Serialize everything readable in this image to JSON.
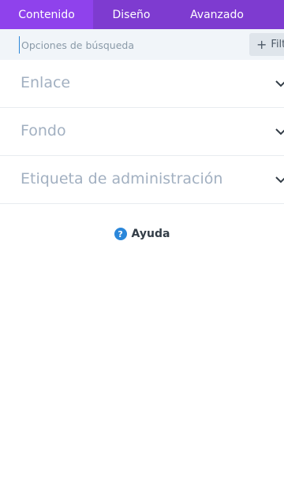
{
  "tabs": [
    {
      "label": "Contenido",
      "active": true
    },
    {
      "label": "Diseño",
      "active": false
    },
    {
      "label": "Avanzado",
      "active": false
    }
  ],
  "search": {
    "placeholder": "Opciones de búsqueda",
    "value": ""
  },
  "filter_button": {
    "label": "Filtro",
    "icon": "plus-icon"
  },
  "groups": [
    {
      "label": "Enlace",
      "icon": "chevron-down-icon"
    },
    {
      "label": "Fondo",
      "icon": "chevron-down-icon"
    },
    {
      "label": "Etiqueta de administración",
      "icon": "chevron-down-icon"
    }
  ],
  "help": {
    "label": "Ayuda",
    "icon": "question-circle-icon"
  },
  "colors": {
    "tab_bar": "#7e3bd0",
    "tab_active": "#8f42ec",
    "search_bg": "#f1f5f9",
    "group_text": "#a2b0c1",
    "help_icon": "#2b87da"
  }
}
